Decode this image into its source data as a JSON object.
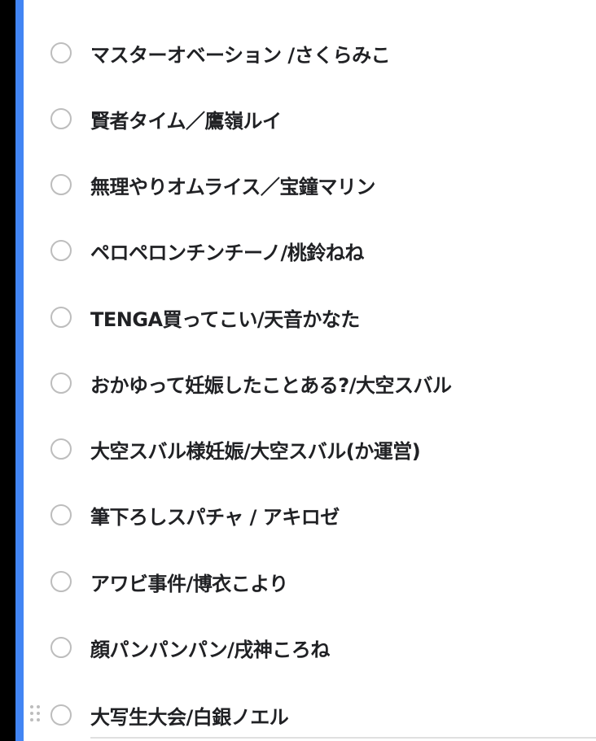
{
  "colors": {
    "accent": "#4285F4",
    "card_background": "#FFFFFF",
    "radio_border": "#BDBDBD",
    "text": "#202124"
  },
  "options": [
    {
      "label": "マスターオベーション /さくらみこ"
    },
    {
      "label": "賢者タイム／鷹嶺ルイ"
    },
    {
      "label": "無理やりオムライス／宝鐘マリン"
    },
    {
      "label": "ペロペロンチンチーノ/桃鈴ねね"
    },
    {
      "label": "TENGA買ってこい/天音かなた"
    },
    {
      "label": "おかゆって妊娠したことある?/大空スバル"
    },
    {
      "label": "大空スバル様妊娠/大空スバル(か運営)"
    },
    {
      "label": "筆下ろしスパチャ / アキロゼ"
    },
    {
      "label": "アワビ事件/博衣こより"
    },
    {
      "label": "顔パンパンパン/戌神ころね"
    },
    {
      "label": "大写生大会/白銀ノエル"
    }
  ]
}
